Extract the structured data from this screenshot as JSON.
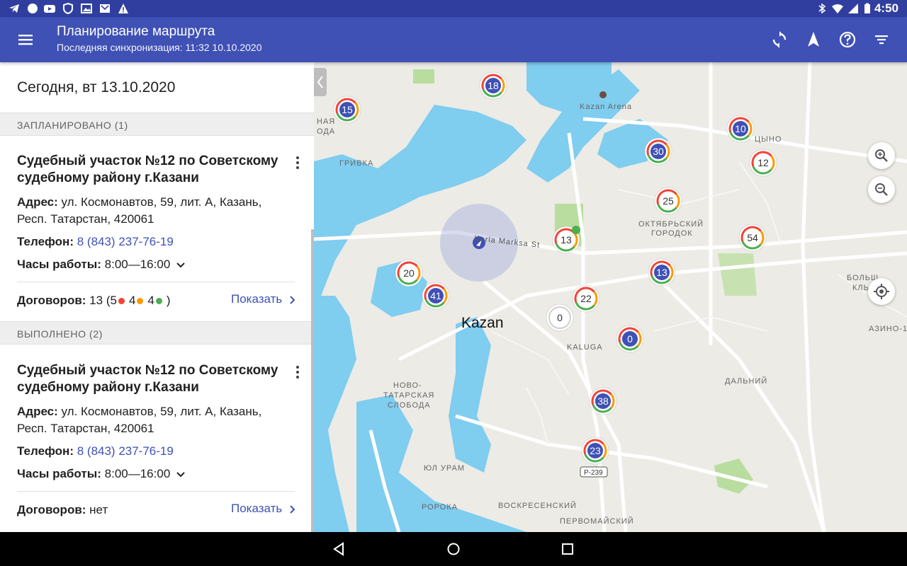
{
  "app": {
    "title": "Планирование маршрута",
    "subtitle": "Последняя синхронизация: 11:32 10.10.2020"
  },
  "statusbar": {
    "time": "4:50"
  },
  "date_header": "Сегодня, вт 13.10.2020",
  "sections": {
    "planned": "ЗАПЛАНИРОВАНО (1)",
    "done": "ВЫПОЛНЕНО (2)"
  },
  "cards": [
    {
      "name": "Судебный участок №12 по Советскому судебному району г.Казани",
      "address_label": "Адрес:",
      "address": "ул. Космонавтов, 59, лит. А, Казань, Респ. Татарстан, 420061",
      "phone_label": "Телефон:",
      "phone": "8 (843) 237-76-19",
      "hours_label": "Часы работы:",
      "hours": "8:00—16:00",
      "contracts_label": "Договоров:",
      "contracts_total": "13",
      "contracts_red": "5",
      "contracts_orange": "4",
      "contracts_green": "4",
      "show_label": "Показать"
    },
    {
      "name": "Судебный участок №12 по Советскому судебному району г.Казани",
      "address_label": "Адрес:",
      "address": "ул. Космонавтов, 59, лит. А, Казань, Респ. Татарстан, 420061",
      "phone_label": "Телефон:",
      "phone": "8 (843) 237-76-19",
      "hours_label": "Часы работы:",
      "hours": "8:00—16:00",
      "contracts_label": "Договоров:",
      "contracts_none": "нет",
      "show_label": "Показать"
    }
  ],
  "map": {
    "city_label": "Kazan",
    "street_label": "Karla Marksa St",
    "arena_label": "Kazan Arena",
    "road_label": "Р-239",
    "districts": [
      "ГРИВКА",
      "ОКТЯБРЬСКИЙ",
      "ГОРОДОК",
      "KALUGA",
      "НОВО-",
      "ТАТАРСКАЯ",
      "СЛОБОДА",
      "ДАЛЬНИЙ",
      "ЮЛ УРАМ",
      "РОРОКА",
      "ВОСКРЕСЕНСКИЙ",
      "ПЕРВОМАЙСКИЙ",
      "АЗИНО-1",
      "БОЛЬШ",
      "КЛЬ",
      "ЦЫНО",
      "НАЯ",
      "ОДА"
    ],
    "markers": [
      {
        "value": "18",
        "style": "filled"
      },
      {
        "value": "15",
        "style": "filled"
      },
      {
        "value": "10",
        "style": "filled"
      },
      {
        "value": "30",
        "style": "filled"
      },
      {
        "value": "12",
        "style": "plain"
      },
      {
        "value": "25",
        "style": "plain"
      },
      {
        "value": "13",
        "style": "plain"
      },
      {
        "value": "54",
        "style": "plain"
      },
      {
        "value": "20",
        "style": "plain"
      },
      {
        "value": "41",
        "style": "filled"
      },
      {
        "value": "13",
        "style": "filled"
      },
      {
        "value": "22",
        "style": "plain"
      },
      {
        "value": "0",
        "style": "gray"
      },
      {
        "value": "0",
        "style": "filled"
      },
      {
        "value": "38",
        "style": "filled"
      },
      {
        "value": "23",
        "style": "filled"
      }
    ]
  },
  "colors": {
    "primary": "#3f51b5",
    "primary_dark": "#303f9f",
    "red": "#f44336",
    "orange": "#ff9800",
    "green": "#4caf50",
    "water": "#7fcdef"
  }
}
